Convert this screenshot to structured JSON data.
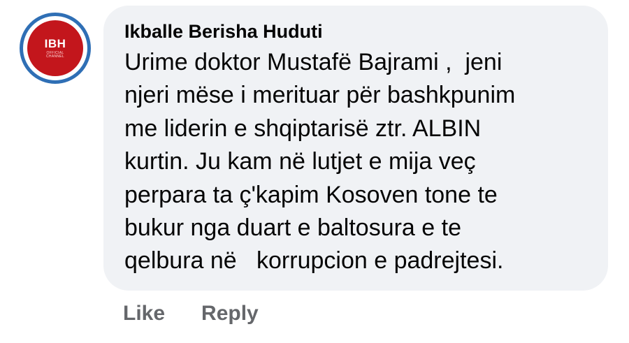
{
  "comment": {
    "avatar": {
      "logo_text": "IBH",
      "logo_subtext": "OFFICIAL CHANNEL",
      "colors": {
        "ring": "#2f6fb5",
        "fill": "#c3161c"
      }
    },
    "author": "Ikballe Berisha Huduti",
    "lines": [
      "Urime doktor Mustafë Bajrami ,  jeni",
      "njeri mëse i merituar për bashkpunim",
      "me liderin e shqiptarisë ztr. ALBIN",
      "kurtin. Ju kam në lutjet e mija veç",
      "perpara ta ç'kapim Kosoven tone te",
      "bukur nga duart e baltosura e te",
      "qelbura në   korrupcion e padrejtesi."
    ],
    "actions": {
      "like_label": "Like",
      "reply_label": "Reply"
    },
    "colors": {
      "bubble": "#f0f2f5",
      "text": "#050505",
      "action_text": "#65676b"
    }
  }
}
